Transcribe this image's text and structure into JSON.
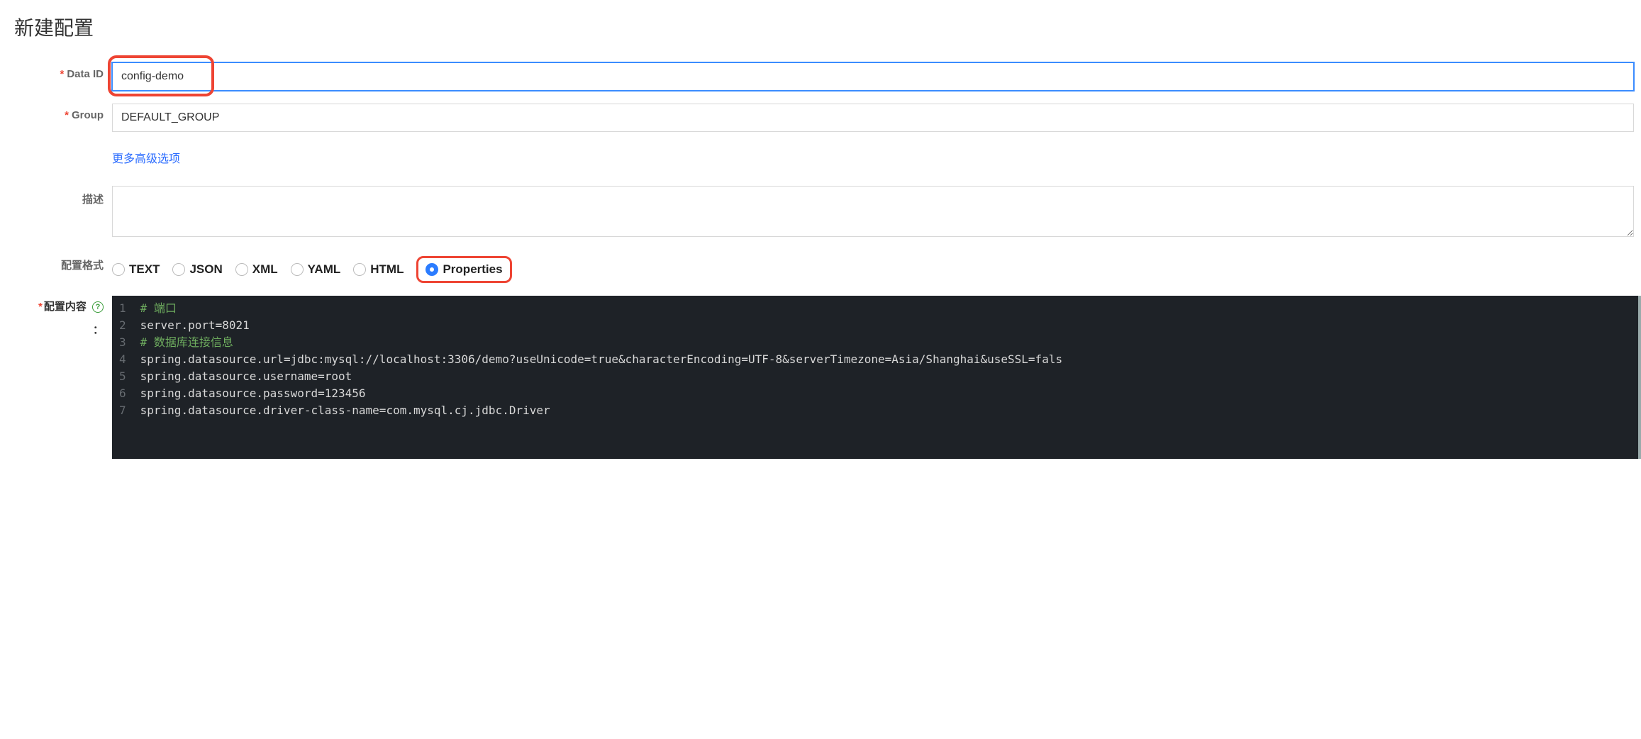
{
  "page": {
    "title": "新建配置"
  },
  "form": {
    "dataId": {
      "label": "Data ID",
      "value": "config-demo"
    },
    "group": {
      "label": "Group",
      "value": "DEFAULT_GROUP"
    },
    "advancedLink": "更多高级选项",
    "description": {
      "label": "描述",
      "value": ""
    },
    "format": {
      "label": "配置格式",
      "options": [
        "TEXT",
        "JSON",
        "XML",
        "YAML",
        "HTML",
        "Properties"
      ],
      "selected": "Properties"
    },
    "content": {
      "label": "配置内容",
      "helpGlyph": "?",
      "colon": "：",
      "lines": [
        {
          "n": 1,
          "type": "comment",
          "text": "# 端口"
        },
        {
          "n": 2,
          "type": "prop",
          "key": "server.port",
          "value": "8021"
        },
        {
          "n": 3,
          "type": "comment",
          "text": "# 数据库连接信息"
        },
        {
          "n": 4,
          "type": "prop",
          "key": "spring.datasource.url",
          "value": "jdbc:mysql://localhost:3306/demo?useUnicode=true&characterEncoding=UTF-8&serverTimezone=Asia/Shanghai&useSSL=fals"
        },
        {
          "n": 5,
          "type": "prop",
          "key": "spring.datasource.username",
          "value": "root"
        },
        {
          "n": 6,
          "type": "prop",
          "key": "spring.datasource.password",
          "value": "123456"
        },
        {
          "n": 7,
          "type": "prop",
          "key": "spring.datasource.driver-class-name",
          "value": "com.mysql.cj.jdbc.Driver"
        }
      ]
    }
  }
}
